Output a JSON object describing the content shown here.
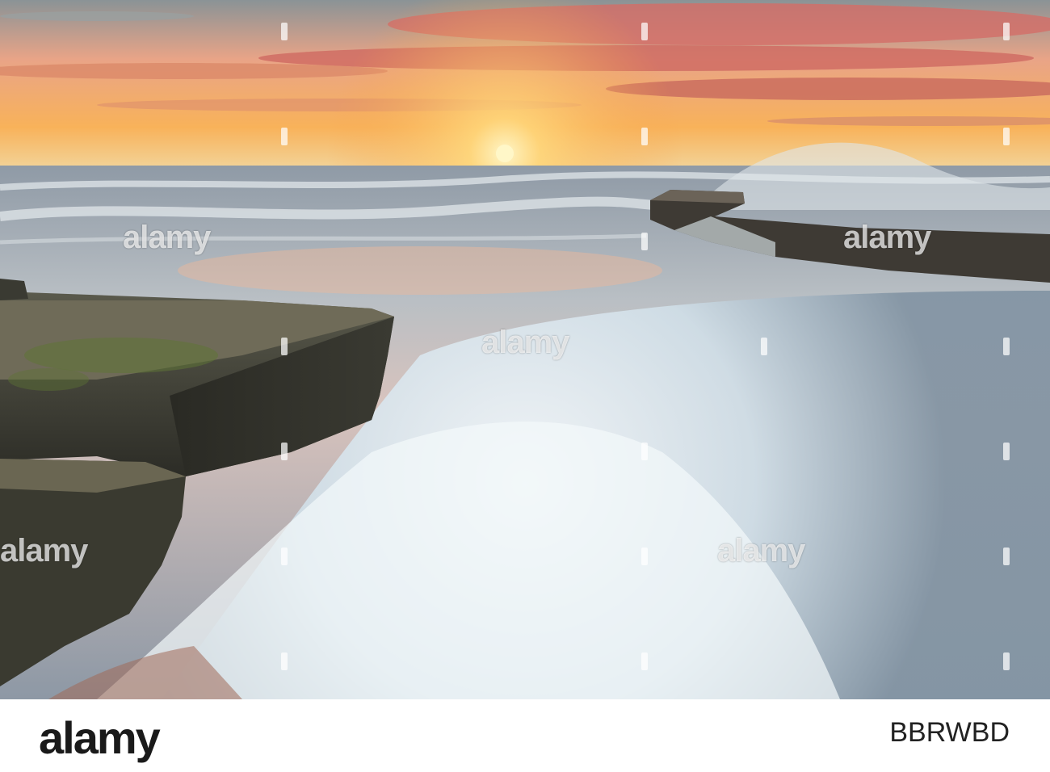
{
  "watermark": {
    "text": "alamy"
  },
  "footer": {
    "logo_text": "alamy",
    "image_id": "BBRWBD"
  },
  "colors": {
    "sky_top": "#7d8a8e",
    "sky_glow": "#f7a24a",
    "sun": "#fff1b0",
    "clouds": "#d9736a",
    "sea": "#6f7f8c",
    "foam": "#e8f0f4",
    "rock": "#3b3b34",
    "moss": "#6f7a3a"
  }
}
